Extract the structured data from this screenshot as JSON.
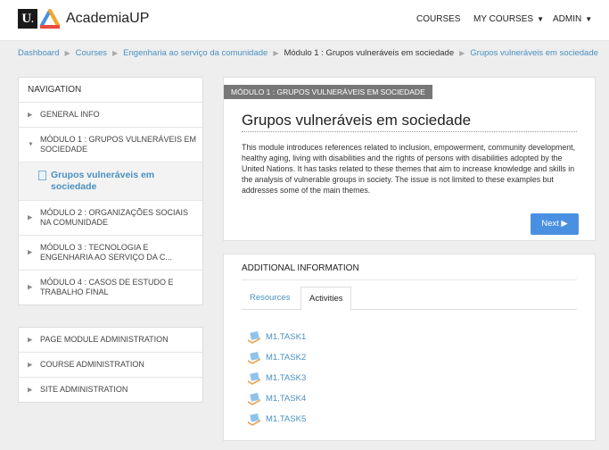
{
  "header": {
    "brand": "AcademiaUP",
    "logo_letter": "U",
    "nav": [
      {
        "label": "COURSES",
        "dropdown": false
      },
      {
        "label": "MY COURSES",
        "dropdown": true
      },
      {
        "label": "ADMIN",
        "dropdown": true
      }
    ]
  },
  "breadcrumb": [
    {
      "label": "Dashboard",
      "link": true
    },
    {
      "label": "Courses",
      "link": true
    },
    {
      "label": "Engenharia ao serviço da comunidade",
      "link": true
    },
    {
      "label": "Módulo 1 : Grupos vulneráveis em sociedade",
      "link": false
    },
    {
      "label": "Grupos vulneráveis em sociedade",
      "link": true
    }
  ],
  "sidebar": {
    "navigation_title": "NAVIGATION",
    "items": [
      {
        "label": "GENERAL INFO",
        "arrow": "▶"
      },
      {
        "label": "MÓDULO 1 : GRUPOS VULNERÁVEIS EM SOCIEDADE",
        "arrow": "▼"
      },
      {
        "label": "Grupos vulneráveis em sociedade",
        "arrow": ""
      },
      {
        "label": "MÓDULO 2 : ORGANIZAÇÕES SOCIAIS NA COMUNIDADE",
        "arrow": "▶"
      },
      {
        "label": "MÓDULO 3 : TECNOLOGIA E ENGENHARIA AO SERVIÇO DA C...",
        "arrow": "▶"
      },
      {
        "label": "MÓDULO 4 : CASOS DE ESTUDO E TRABALHO FINAL",
        "arrow": "▶"
      }
    ],
    "admin_items": [
      {
        "label": "PAGE MODULE ADMINISTRATION",
        "arrow": "▶"
      },
      {
        "label": "COURSE ADMINISTRATION",
        "arrow": "▶"
      },
      {
        "label": "SITE ADMINISTRATION",
        "arrow": "▶"
      }
    ]
  },
  "module": {
    "tag": "MÓDULO 1 : GRUPOS VULNERÁVEIS EM SOCIEDADE",
    "title": "Grupos vulneráveis em sociedade",
    "description": "This module introduces references related to inclusion, empowerment, community development, healthy aging, living with disabilities and the rights of persons with disabilities adopted by the United Nations. It has tasks related to these themes that aim to increase knowledge and skills in the analysis of vulnerable groups in society. The issue is not limited to these examples but addresses some of the main themes.",
    "next_label": "Next ▶"
  },
  "additional": {
    "title": "ADDITIONAL INFORMATION",
    "tabs": [
      {
        "label": "Resources",
        "active": false
      },
      {
        "label": "Activities",
        "active": true
      }
    ],
    "activities": [
      "M1.TASK1",
      "M1.TASK2",
      "M1.TASK3",
      "M1.TASK4",
      "M1.TASK5"
    ]
  },
  "colors": {
    "link": "#4a90c2",
    "accent_button": "#4a90e2",
    "tag_bg": "#777777",
    "page_bg": "#eeeeee"
  }
}
